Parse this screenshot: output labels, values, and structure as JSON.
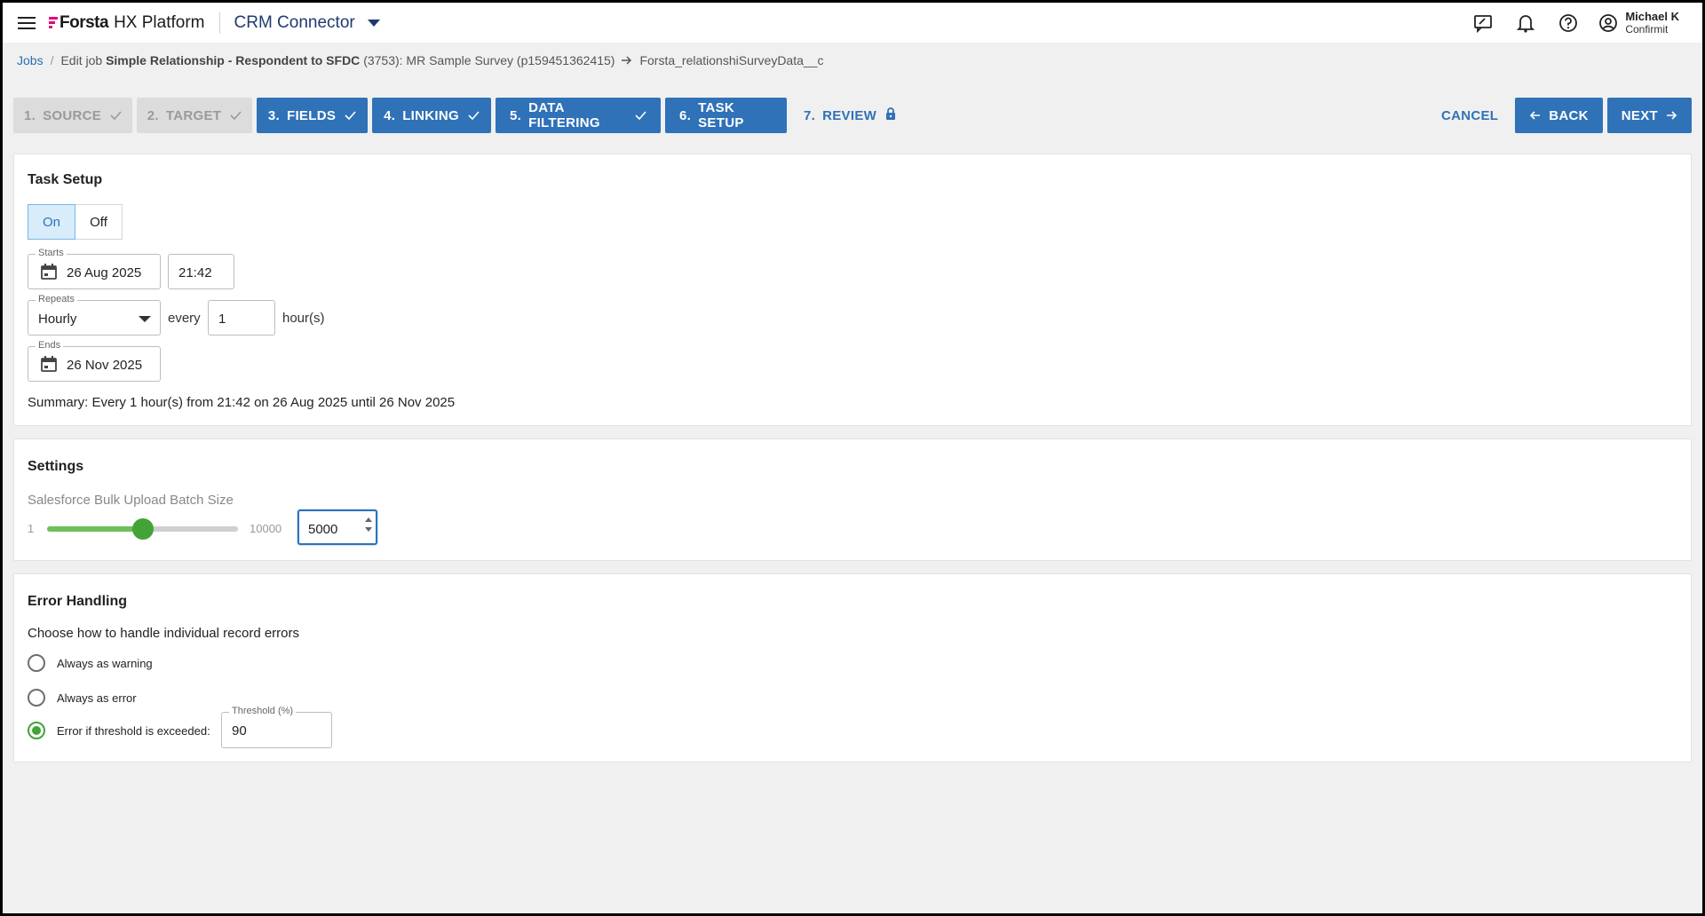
{
  "header": {
    "brand": "Forsta",
    "platform": "HX Platform",
    "app_name": "CRM Connector",
    "user_name": "Michael K",
    "user_org": "Confirmit",
    "icons": [
      "feedback-icon",
      "bell-icon",
      "help-icon",
      "account-icon"
    ]
  },
  "breadcrumb": {
    "root": "Jobs",
    "edit_prefix": "Edit job",
    "job_name": "Simple Relationship - Respondent to SFDC",
    "job_detail": "(3753): MR Sample Survey (p159451362415)",
    "target": "Forsta_relationshiSurveyData__c"
  },
  "steps": [
    {
      "num": "1.",
      "label": "SOURCE",
      "state": "done-grey"
    },
    {
      "num": "2.",
      "label": "TARGET",
      "state": "done-grey"
    },
    {
      "num": "3.",
      "label": "FIELDS",
      "state": "done-blue"
    },
    {
      "num": "4.",
      "label": "LINKING",
      "state": "done-blue"
    },
    {
      "num": "5.",
      "label": "DATA FILTERING",
      "state": "done-blue"
    },
    {
      "num": "6.",
      "label": "TASK SETUP",
      "state": "current"
    },
    {
      "num": "7.",
      "label": "REVIEW",
      "state": "locked"
    }
  ],
  "nav": {
    "cancel": "CANCEL",
    "back": "BACK",
    "next": "NEXT"
  },
  "task_setup": {
    "title": "Task Setup",
    "toggle_on": "On",
    "toggle_off": "Off",
    "toggle_selected": "On",
    "starts_label": "Starts",
    "starts_date": "26 Aug 2025",
    "starts_time": "21:42",
    "repeats_label": "Repeats",
    "repeats_value": "Hourly",
    "every_label": "every",
    "every_value": "1",
    "unit_label": "hour(s)",
    "ends_label": "Ends",
    "ends_date": "26 Nov 2025",
    "summary": "Summary: Every 1 hour(s) from 21:42 on 26 Aug 2025 until 26 Nov 2025"
  },
  "settings": {
    "title": "Settings",
    "batch_label": "Salesforce Bulk Upload Batch Size",
    "slider_min": "1",
    "slider_max": "10000",
    "batch_value": "5000",
    "slider_fraction": 0.5
  },
  "error_handling": {
    "title": "Error Handling",
    "subtitle": "Choose how to handle individual record errors",
    "options": [
      {
        "label": "Always as warning",
        "checked": false
      },
      {
        "label": "Always as error",
        "checked": false
      },
      {
        "label": "Error if threshold is exceeded:",
        "checked": true
      }
    ],
    "threshold_label": "Threshold (%)",
    "threshold_value": "90"
  },
  "colors": {
    "primary": "#2f72b8",
    "success": "#43a337",
    "brand_accent": "#e4007c"
  }
}
